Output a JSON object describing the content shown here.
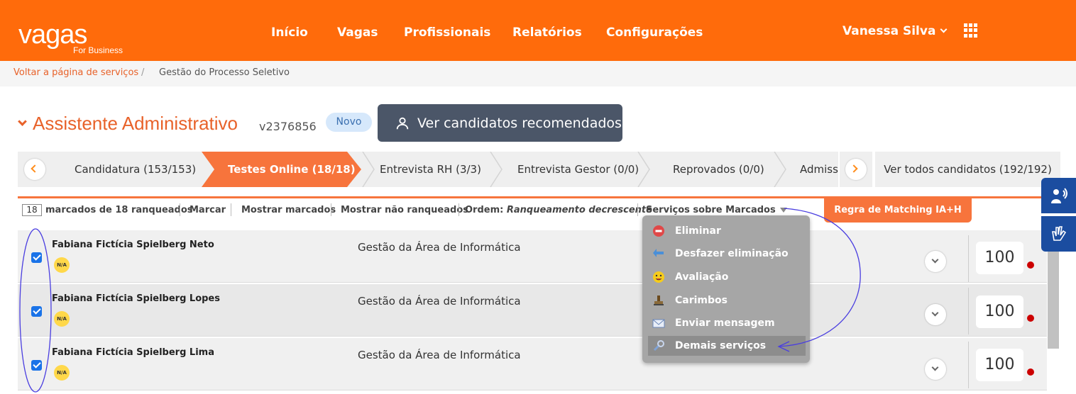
{
  "header": {
    "logo_word": "vagas",
    "logo_sub": "For Business",
    "nav": [
      "Início",
      "Vagas",
      "Profissionais",
      "Relatórios",
      "Configurações"
    ],
    "user_name": "Vanessa Silva",
    "apps_icon": "grid-icon"
  },
  "breadcrumb": {
    "back_link": "Voltar a página de serviços",
    "separator": "/",
    "current": "Gestão do Processo Seletivo"
  },
  "job": {
    "title": "Assistente Administrativo",
    "code": "v2376856",
    "badge": "Novo",
    "recommend_button": "Ver candidatos recomendados"
  },
  "tabs": {
    "items": [
      "Candidatura (153/153)",
      "Testes Online (18/18)",
      "Entrevista RH (3/3)",
      "Entrevista Gestor (0/0)",
      "Reprovados (0/0)",
      "Admissã"
    ],
    "active_index": 1,
    "view_all": "Ver todos candidatos (192/192)"
  },
  "toolbar": {
    "count": "18",
    "marked_text": "marcados de 18 ranqueados",
    "marcar": "Marcar",
    "mostrar_marcados": "Mostrar marcados",
    "mostrar_nao_ranqueados": "Mostrar não ranqueados",
    "ordem_label": "Ordem:",
    "ordem_value": "Ranqueamento decrescente",
    "servicos": "Serviços sobre Marcados",
    "matching_button": "Regra de Matching IA+H"
  },
  "candidates": [
    {
      "name": "Fabiana Fictícia Spielberg Neto",
      "badge": "N/A",
      "area": "Gestão da Área de Informática",
      "score": "100",
      "checked": true
    },
    {
      "name": "Fabiana Fictícia Spielberg Lopes",
      "badge": "N/A",
      "area": "Gestão da Área de Informática",
      "score": "100",
      "checked": true
    },
    {
      "name": "Fabiana Fictícia Spielberg Lima",
      "badge": "N/A",
      "area": "Gestão da Área de Informática",
      "score": "100",
      "checked": true
    }
  ],
  "services_menu": {
    "items": [
      {
        "label": "Eliminar",
        "icon": "remove-icon"
      },
      {
        "label": "Desfazer eliminação",
        "icon": "undo-arrow-icon"
      },
      {
        "label": "Avaliação",
        "icon": "smiley-icon"
      },
      {
        "label": "Carimbos",
        "icon": "stamp-icon"
      },
      {
        "label": "Enviar mensagem",
        "icon": "envelope-icon"
      },
      {
        "label": "Demais serviços",
        "icon": "wrench-icon"
      }
    ],
    "highlighted_index": 5
  },
  "colors": {
    "brand": "#ff6b0b",
    "accent": "#f7743c",
    "annotation": "#4a3ee0"
  }
}
